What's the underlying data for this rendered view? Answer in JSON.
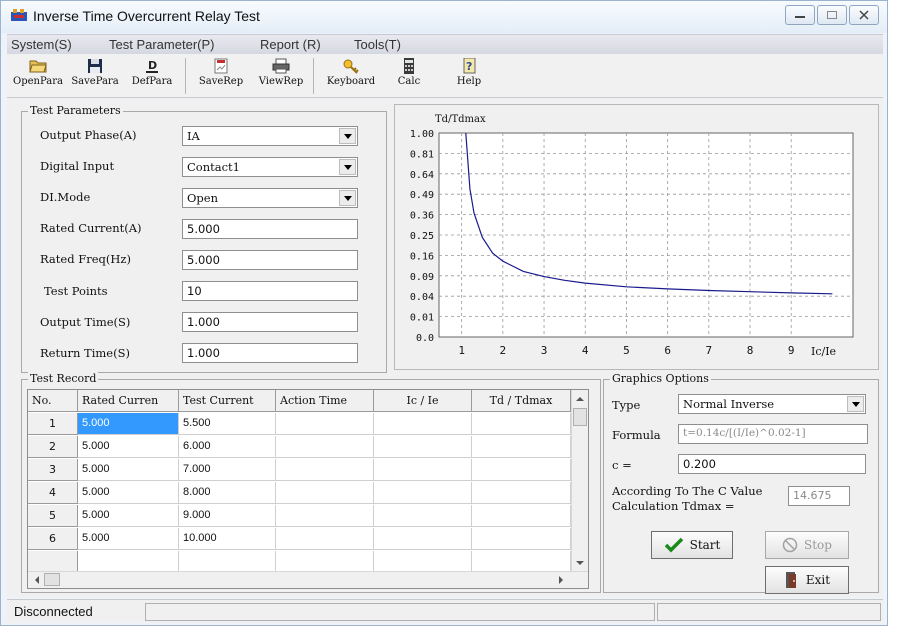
{
  "window": {
    "title": "Inverse Time Overcurrent Relay Test"
  },
  "menu": [
    "System(S)",
    "Test Parameter(P)",
    "Report (R)",
    "Tools(T)"
  ],
  "toolbar": {
    "open": "OpenPara",
    "save": "SavePara",
    "def": "DefPara",
    "saverep": "SaveRep",
    "viewrep": "ViewRep",
    "keyboard": "Keyboard",
    "calc": "Calc",
    "help": "Help"
  },
  "params": {
    "title": "Test Parameters",
    "output_phase": {
      "label": "Output Phase(A)",
      "value": "IA"
    },
    "digital_input": {
      "label": "Digital Input",
      "value": "Contact1"
    },
    "di_mode": {
      "label": "DI.Mode",
      "value": "Open"
    },
    "rated_current": {
      "label": "Rated Current(A)",
      "value": "5.000"
    },
    "rated_freq": {
      "label": "Rated Freq(Hz)",
      "value": "5.000"
    },
    "test_points": {
      "label": "Test Points",
      "value": "10"
    },
    "output_time": {
      "label": "Output Time(S)",
      "value": "1.000"
    },
    "return_time": {
      "label": "Return Time(S)",
      "value": "1.000"
    }
  },
  "chart_data": {
    "type": "line",
    "ylabel": "Td/Tdmax",
    "xlabel": "Ic/Ie",
    "x_ticks": [
      "1",
      "2",
      "3",
      "4",
      "5",
      "6",
      "7",
      "8",
      "9"
    ],
    "y_ticks": [
      "1.00",
      "0.81",
      "0.64",
      "0.49",
      "0.36",
      "0.25",
      "0.16",
      "0.09",
      "0.04",
      "0.01",
      "0.0"
    ],
    "grid": true,
    "series": [
      {
        "color": "#1a1a8c",
        "x": [
          1.1,
          1.2,
          1.3,
          1.5,
          1.75,
          2.0,
          2.5,
          3.0,
          3.5,
          4.0,
          5.0,
          6.0,
          7.0,
          8.0,
          9.0,
          10.0
        ],
        "y": [
          1.0,
          0.53,
          0.37,
          0.24,
          0.17,
          0.14,
          0.105,
          0.088,
          0.079,
          0.072,
          0.063,
          0.058,
          0.054,
          0.051,
          0.048,
          0.046
        ]
      }
    ]
  },
  "record": {
    "title": "Test Record",
    "columns": [
      "No.",
      "Rated Curren",
      "Test Current",
      "Action Time",
      "Ic / Ie",
      "Td / Tdmax"
    ],
    "rows": [
      [
        "1",
        "5.000",
        "5.500"
      ],
      [
        "2",
        "5.000",
        "6.000"
      ],
      [
        "3",
        "5.000",
        "7.000"
      ],
      [
        "4",
        "5.000",
        "8.000"
      ],
      [
        "5",
        "5.000",
        "9.000"
      ],
      [
        "6",
        "5.000",
        "10.000"
      ]
    ]
  },
  "graphics": {
    "title": "Graphics Options",
    "type_label": "Type",
    "type_value": "Normal Inverse",
    "formula_label": "Formula",
    "formula_value": "t=0.14c/[(I/Ie)^0.02-1]",
    "c_label": "c =",
    "c_value": "0.200",
    "tdmax_label_1": "According To The C Value",
    "tdmax_label_2": "Calculation Tdmax =",
    "tdmax_value": "14.675"
  },
  "buttons": {
    "start": "Start",
    "stop": "Stop",
    "exit": "Exit"
  },
  "status": {
    "text": "Disconnected"
  },
  "colors": {
    "selection": "#3399ff",
    "curve": "#1a1a8c",
    "start_check": "#1a8a1a"
  }
}
